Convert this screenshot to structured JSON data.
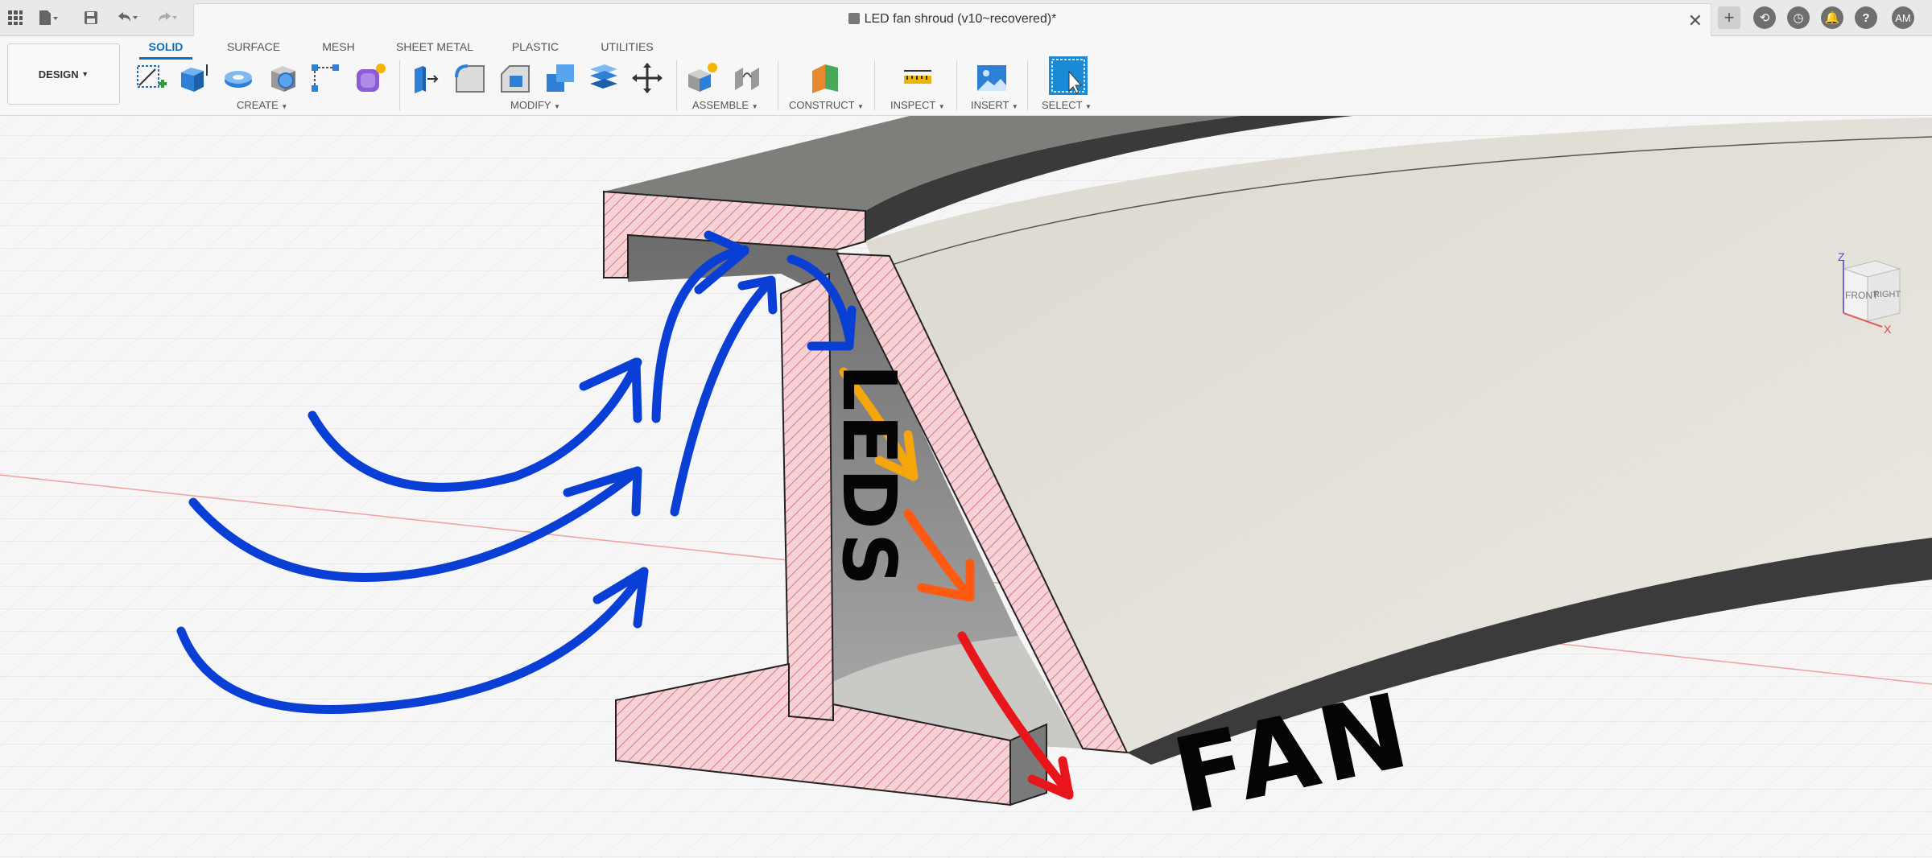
{
  "titlebar": {
    "document_title": "LED fan shroud (v10~recovered)*",
    "user_initials": "AM"
  },
  "workspace": {
    "mode_label": "DESIGN"
  },
  "tabs": [
    "SOLID",
    "SURFACE",
    "MESH",
    "SHEET METAL",
    "PLASTIC",
    "UTILITIES"
  ],
  "active_tab": "SOLID",
  "groups": {
    "create": "CREATE",
    "modify": "MODIFY",
    "assemble": "ASSEMBLE",
    "construct": "CONSTRUCT",
    "inspect": "INSPECT",
    "insert": "INSERT",
    "select": "SELECT"
  },
  "annotations": {
    "leds": "LEDS",
    "fan": "FAN"
  },
  "view_cube": {
    "front": "FRONT",
    "right": "RIGHT",
    "z_axis": "Z",
    "x_axis": "X"
  },
  "colors": {
    "accent": "#0d6fb8",
    "airflow_blue": "#0a3fd6",
    "heat_orange": "#f5a60a",
    "heat_deep_orange": "#ff5a12",
    "heat_red": "#e8161a",
    "section_hatch": "#f6d2d6"
  }
}
